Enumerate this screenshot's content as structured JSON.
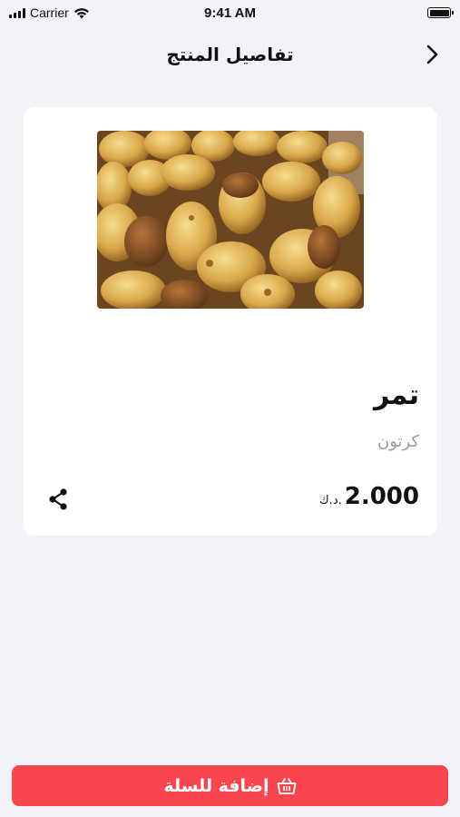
{
  "status_bar": {
    "carrier": "Carrier",
    "time": "9:41 AM"
  },
  "header": {
    "title": "تفاصيل المنتج",
    "back_icon": "chevron-right-icon"
  },
  "product": {
    "image_alt": "dates-photo",
    "name": "تمر",
    "unit": "كرتون",
    "price": "2.000",
    "currency": "د.ك.",
    "share_icon": "share-icon"
  },
  "actions": {
    "add_to_cart_label": "إضافة للسلة",
    "cart_icon": "basket-icon"
  },
  "colors": {
    "background": "#f1f3f8",
    "card": "#ffffff",
    "accent": "#f9464f",
    "muted_text": "#9a9aa2"
  }
}
